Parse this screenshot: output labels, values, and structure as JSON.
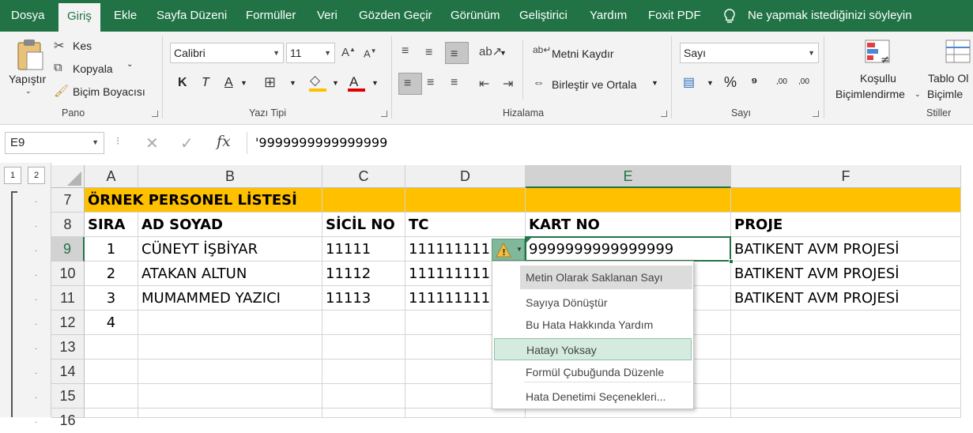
{
  "menu": {
    "tabs": [
      "Dosya",
      "Giriş",
      "Ekle",
      "Sayfa Düzeni",
      "Formüller",
      "Veri",
      "Gözden Geçir",
      "Görünüm",
      "Geliştirici",
      "Yardım",
      "Foxit PDF"
    ],
    "active_tab": "Giriş",
    "tell_me": "Ne yapmak istediğinizi söyleyin"
  },
  "ribbon": {
    "clipboard": {
      "paste": "Yapıştır",
      "cut": "Kes",
      "copy": "Kopyala",
      "format_painter": "Biçim Boyacısı",
      "group": "Pano"
    },
    "font": {
      "name": "Calibri",
      "size": "11",
      "bold": "K",
      "italic": "T",
      "underline": "A",
      "font_color": "A",
      "group": "Yazı Tipi"
    },
    "alignment": {
      "wrap": "Metni Kaydır",
      "merge": "Birleştir ve Ortala",
      "group": "Hizalama"
    },
    "number": {
      "format": "Sayı",
      "percent": "%",
      "comma": "⁹",
      "inc_decimal": ",00",
      "dec_decimal": ",00",
      "group": "Sayı"
    },
    "styles": {
      "conditional_line1": "Koşullu",
      "conditional_line2": "Biçimlendirme",
      "table_line1": "Tablo Ol",
      "table_line2": "Biçimle",
      "group": "Stiller"
    }
  },
  "formula_bar": {
    "name_box": "E9",
    "fx": "fx",
    "content": "'9999999999999999"
  },
  "outline_levels": [
    "1",
    "2"
  ],
  "columns": [
    "A",
    "B",
    "C",
    "D",
    "E",
    "F"
  ],
  "rows": [
    {
      "num": "7",
      "cells": [
        "ÖRNEK PERSONEL LİSTESİ",
        "",
        "",
        "",
        "",
        ""
      ]
    },
    {
      "num": "8",
      "cells": [
        "SIRA",
        "AD SOYAD",
        "SİCİL NO",
        "TC",
        "KART NO",
        "PROJE"
      ]
    },
    {
      "num": "9",
      "cells": [
        "1",
        "CÜNEYT İŞBİYAR",
        "11111",
        "111111111",
        "9999999999999999",
        "BATIKENT AVM PROJESİ"
      ]
    },
    {
      "num": "10",
      "cells": [
        "2",
        "ATAKAN ALTUN",
        "11112",
        "111111111",
        "",
        "BATIKENT AVM PROJESİ"
      ]
    },
    {
      "num": "11",
      "cells": [
        "3",
        "MUMAMMED YAZICI",
        "11113",
        "111111111",
        "",
        "BATIKENT AVM PROJESİ"
      ]
    },
    {
      "num": "12",
      "cells": [
        "4",
        "",
        "",
        "",
        "",
        ""
      ]
    },
    {
      "num": "13",
      "cells": [
        "",
        "",
        "",
        "",
        "",
        ""
      ]
    },
    {
      "num": "14",
      "cells": [
        "",
        "",
        "",
        "",
        "",
        ""
      ]
    },
    {
      "num": "15",
      "cells": [
        "",
        "",
        "",
        "",
        "",
        ""
      ]
    },
    {
      "num": "16",
      "cells": [
        "",
        "",
        "",
        "",
        "",
        ""
      ]
    }
  ],
  "error_menu": {
    "header": "Metin Olarak Saklanan Sayı",
    "items": [
      "Sayıya Dönüştür",
      "Bu Hata Hakkında Yardım",
      "Hatayı Yoksay",
      "Formül Çubuğunda Düzenle",
      "Hata Denetimi Seçenekleri..."
    ]
  },
  "colors": {
    "excel_green": "#217346",
    "title_fill": "#ffc000",
    "selection": "#217346",
    "menu_hover": "#d5ebe0"
  }
}
